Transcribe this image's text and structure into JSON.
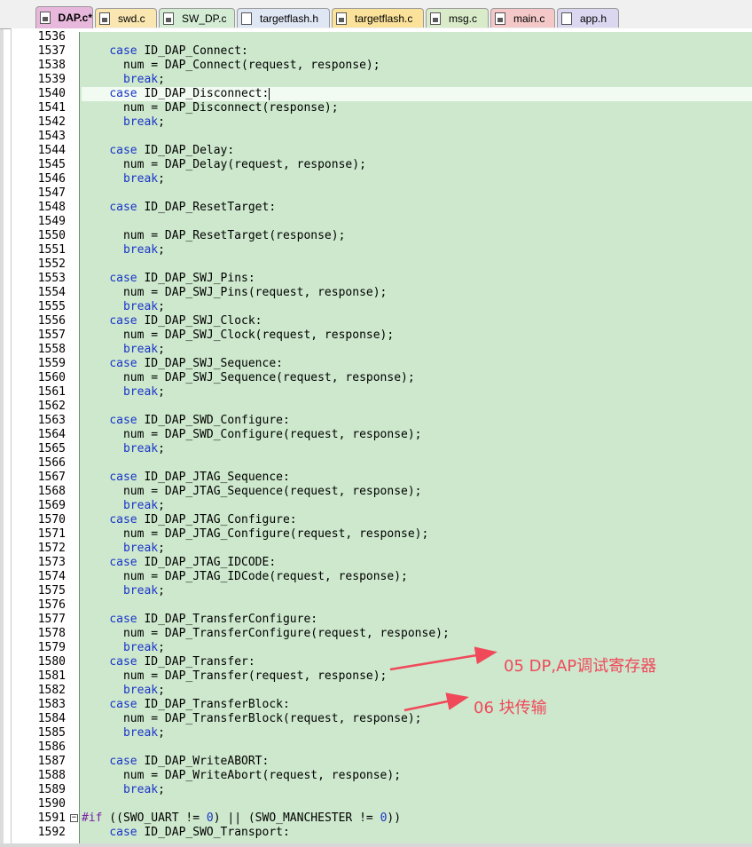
{
  "tabs": [
    {
      "label": "DAP.c*",
      "color": "#e8b8dc",
      "icon": "c-file-icon",
      "active": true
    },
    {
      "label": "swd.c",
      "color": "#f9e6b0",
      "icon": "c-file-icon"
    },
    {
      "label": "SW_DP.c",
      "color": "#d4ecd4",
      "icon": "c-file-icon"
    },
    {
      "label": "targetflash.h",
      "color": "#dfe6f4",
      "icon": "h-file-icon"
    },
    {
      "label": "targetflash.c",
      "color": "#fbe29a",
      "icon": "c-file-icon"
    },
    {
      "label": "msg.c",
      "color": "#d9ebc9",
      "icon": "c-file-icon"
    },
    {
      "label": "main.c",
      "color": "#f4c8c8",
      "icon": "c-file-icon"
    },
    {
      "label": "app.h",
      "color": "#dcd7f0",
      "icon": "h-file-icon"
    }
  ],
  "editor": {
    "code_background": "#cde8cd",
    "keyword_color": "#1a35c8",
    "current_line": "1540",
    "lines": [
      {
        "n": "1536",
        "t": ""
      },
      {
        "n": "1537",
        "t": "    case ID_DAP_Connect:"
      },
      {
        "n": "1538",
        "t": "      num = DAP_Connect(request, response);"
      },
      {
        "n": "1539",
        "t": "      break;"
      },
      {
        "n": "1540",
        "t": "    case ID_DAP_Disconnect:"
      },
      {
        "n": "1541",
        "t": "      num = DAP_Disconnect(response);"
      },
      {
        "n": "1542",
        "t": "      break;"
      },
      {
        "n": "1543",
        "t": ""
      },
      {
        "n": "1544",
        "t": "    case ID_DAP_Delay:"
      },
      {
        "n": "1545",
        "t": "      num = DAP_Delay(request, response);"
      },
      {
        "n": "1546",
        "t": "      break;"
      },
      {
        "n": "1547",
        "t": ""
      },
      {
        "n": "1548",
        "t": "    case ID_DAP_ResetTarget:"
      },
      {
        "n": "1549",
        "t": ""
      },
      {
        "n": "1550",
        "t": "      num = DAP_ResetTarget(response);"
      },
      {
        "n": "1551",
        "t": "      break;"
      },
      {
        "n": "1552",
        "t": ""
      },
      {
        "n": "1553",
        "t": "    case ID_DAP_SWJ_Pins:"
      },
      {
        "n": "1554",
        "t": "      num = DAP_SWJ_Pins(request, response);"
      },
      {
        "n": "1555",
        "t": "      break;"
      },
      {
        "n": "1556",
        "t": "    case ID_DAP_SWJ_Clock:"
      },
      {
        "n": "1557",
        "t": "      num = DAP_SWJ_Clock(request, response);"
      },
      {
        "n": "1558",
        "t": "      break;"
      },
      {
        "n": "1559",
        "t": "    case ID_DAP_SWJ_Sequence:"
      },
      {
        "n": "1560",
        "t": "      num = DAP_SWJ_Sequence(request, response);"
      },
      {
        "n": "1561",
        "t": "      break;"
      },
      {
        "n": "1562",
        "t": ""
      },
      {
        "n": "1563",
        "t": "    case ID_DAP_SWD_Configure:"
      },
      {
        "n": "1564",
        "t": "      num = DAP_SWD_Configure(request, response);"
      },
      {
        "n": "1565",
        "t": "      break;"
      },
      {
        "n": "1566",
        "t": ""
      },
      {
        "n": "1567",
        "t": "    case ID_DAP_JTAG_Sequence:"
      },
      {
        "n": "1568",
        "t": "      num = DAP_JTAG_Sequence(request, response);"
      },
      {
        "n": "1569",
        "t": "      break;"
      },
      {
        "n": "1570",
        "t": "    case ID_DAP_JTAG_Configure:"
      },
      {
        "n": "1571",
        "t": "      num = DAP_JTAG_Configure(request, response);"
      },
      {
        "n": "1572",
        "t": "      break;"
      },
      {
        "n": "1573",
        "t": "    case ID_DAP_JTAG_IDCODE:"
      },
      {
        "n": "1574",
        "t": "      num = DAP_JTAG_IDCode(request, response);"
      },
      {
        "n": "1575",
        "t": "      break;"
      },
      {
        "n": "1576",
        "t": ""
      },
      {
        "n": "1577",
        "t": "    case ID_DAP_TransferConfigure:"
      },
      {
        "n": "1578",
        "t": "      num = DAP_TransferConfigure(request, response);"
      },
      {
        "n": "1579",
        "t": "      break;"
      },
      {
        "n": "1580",
        "t": "    case ID_DAP_Transfer:"
      },
      {
        "n": "1581",
        "t": "      num = DAP_Transfer(request, response);"
      },
      {
        "n": "1582",
        "t": "      break;"
      },
      {
        "n": "1583",
        "t": "    case ID_DAP_TransferBlock:"
      },
      {
        "n": "1584",
        "t": "      num = DAP_TransferBlock(request, response);"
      },
      {
        "n": "1585",
        "t": "      break;"
      },
      {
        "n": "1586",
        "t": ""
      },
      {
        "n": "1587",
        "t": "    case ID_DAP_WriteABORT:"
      },
      {
        "n": "1588",
        "t": "      num = DAP_WriteAbort(request, response);"
      },
      {
        "n": "1589",
        "t": "      break;"
      },
      {
        "n": "1590",
        "t": ""
      },
      {
        "n": "1591",
        "t": "#if ((SWO_UART != 0) || (SWO_MANCHESTER != 0))",
        "fold": "minus"
      },
      {
        "n": "1592",
        "t": "    case ID_DAP_SWO_Transport:"
      }
    ]
  },
  "annotations": {
    "color": "#f0495a",
    "note_dp_ap": "05 DP,AP调试寄存器",
    "note_block": "06 块传输"
  }
}
